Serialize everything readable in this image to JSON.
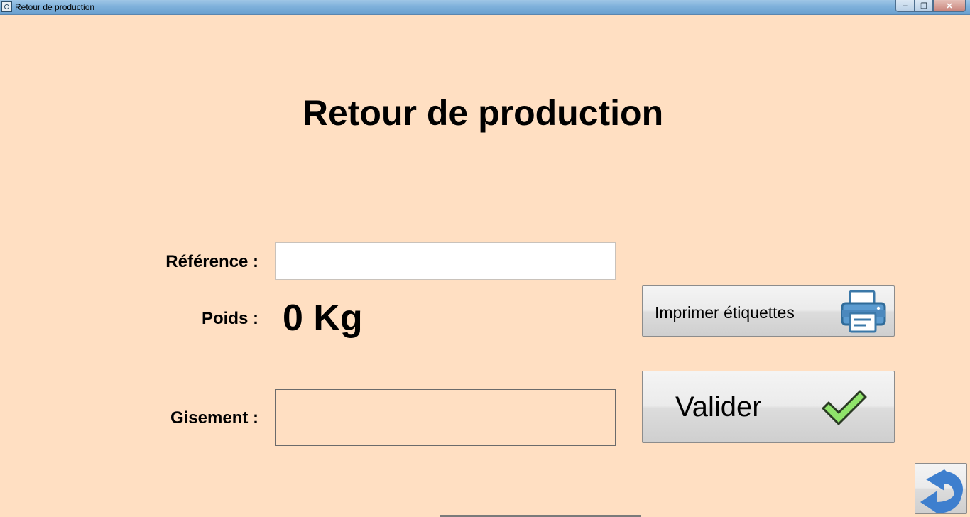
{
  "window": {
    "title": "Retour de production",
    "controls": {
      "minimize": "–",
      "maximize": "❐",
      "close": "✕"
    }
  },
  "page": {
    "title": "Retour de production"
  },
  "form": {
    "reference_label": "Référence :",
    "reference_value": "",
    "reference_placeholder": "",
    "poids_label": "Poids :",
    "poids_value": "0 Kg",
    "gisement_label": "Gisement :",
    "gisement_value": ""
  },
  "buttons": {
    "print_label": "Imprimer  étiquettes",
    "print_icon": "printer-icon",
    "valider_label": "Valider",
    "valider_icon": "check-icon",
    "back_icon": "back-arrow-icon"
  },
  "colors": {
    "background": "#ffdfc2",
    "printer_icon": "#3b78a8",
    "check_icon": "#8fe36a",
    "back_icon": "#3e7fce"
  }
}
